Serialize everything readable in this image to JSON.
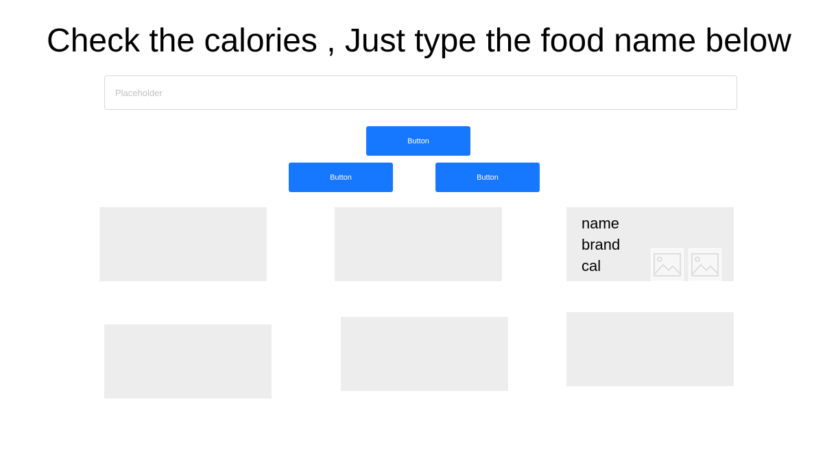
{
  "header": {
    "title": "Check the calories , Just type the food name below"
  },
  "search": {
    "placeholder": "Placeholder",
    "value": ""
  },
  "buttons": {
    "primary_label": "Button",
    "left_label": "Button",
    "right_label": "Button"
  },
  "cards": [
    {
      "name": "",
      "brand": "",
      "cal": ""
    },
    {
      "name": "",
      "brand": "",
      "cal": ""
    },
    {
      "name": "name",
      "brand": "brand",
      "cal": "cal",
      "images": [
        "image-placeholder-icon",
        "image-placeholder-icon"
      ]
    },
    {
      "name": "",
      "brand": "",
      "cal": ""
    },
    {
      "name": "",
      "brand": "",
      "cal": ""
    },
    {
      "name": "",
      "brand": "",
      "cal": ""
    }
  ],
  "colors": {
    "button_bg": "#1677ff",
    "card_bg": "#ededed",
    "input_border": "#d9d9d9",
    "placeholder_text": "#bfbfbf"
  }
}
